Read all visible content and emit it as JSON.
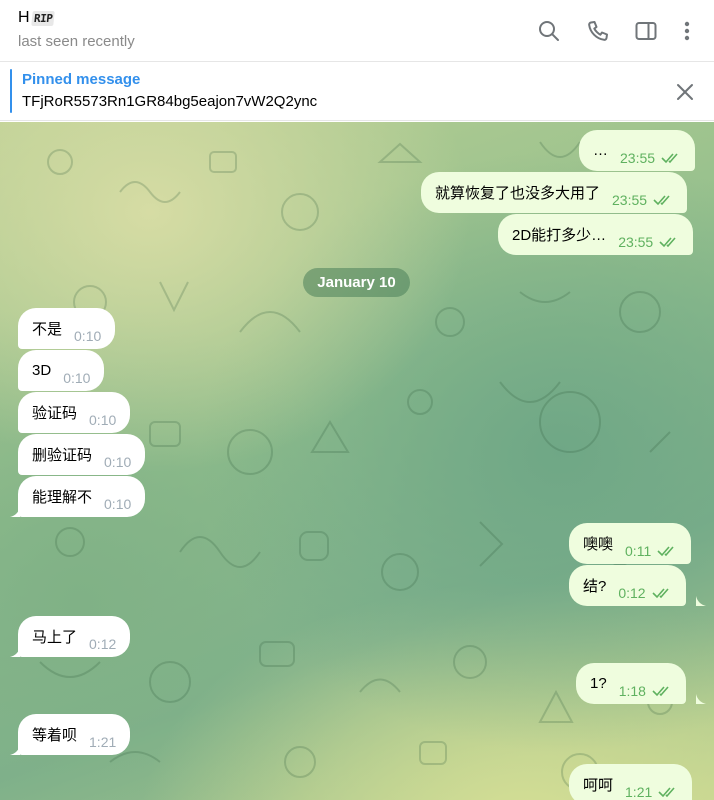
{
  "header": {
    "name_prefix": "H",
    "name_badge": "RIP",
    "status": "last seen recently",
    "icons": [
      "search-icon",
      "phone-icon",
      "sidebar-toggle-icon",
      "more-vertical-icon"
    ]
  },
  "pinned": {
    "title": "Pinned message",
    "text": "TFjRoR5573Rn1GR84bg5eajon7vW2Q2ync"
  },
  "date_separator": "January 10",
  "messages": [
    {
      "dir": "out",
      "text": "…",
      "time": "23:55",
      "read": true
    },
    {
      "dir": "out",
      "text": "就算恢复了也没多大用了",
      "time": "23:55",
      "read": true
    },
    {
      "dir": "out",
      "text": "2D能打多少…",
      "time": "23:55",
      "read": true
    },
    {
      "dir": "in",
      "text": "不是",
      "time": "0:10"
    },
    {
      "dir": "in",
      "text": "3D",
      "time": "0:10"
    },
    {
      "dir": "in",
      "text": "验证码",
      "time": "0:10"
    },
    {
      "dir": "in",
      "text": "删验证码",
      "time": "0:10"
    },
    {
      "dir": "in",
      "text": "能理解不",
      "time": "0:10"
    },
    {
      "dir": "out",
      "text": "噢噢",
      "time": "0:11",
      "read": true
    },
    {
      "dir": "out",
      "text": "结?",
      "time": "0:12",
      "read": true
    },
    {
      "dir": "in",
      "text": "马上了",
      "time": "0:12"
    },
    {
      "dir": "out",
      "text": "1?",
      "time": "1:18",
      "read": true
    },
    {
      "dir": "in",
      "text": "等着呗",
      "time": "1:21"
    },
    {
      "dir": "out",
      "text": "呵呵",
      "time": "1:21",
      "read": true
    }
  ],
  "colors": {
    "accent": "#3390ec",
    "outgoing_bubble": "#effdde",
    "outgoing_time": "#5fb15f",
    "incoming_bubble": "#ffffff",
    "incoming_time": "#a0acb6"
  }
}
